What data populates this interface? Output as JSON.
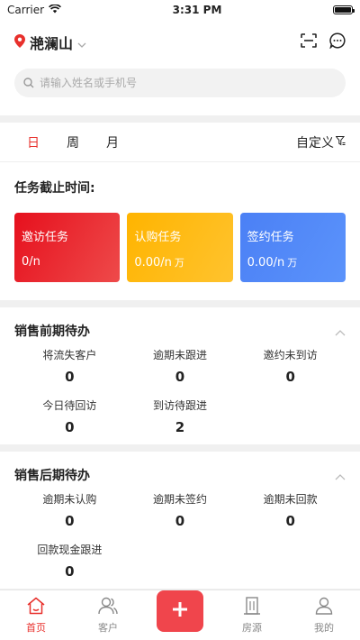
{
  "status_bar": {
    "carrier": "Carrier",
    "time": "3:31 PM",
    "battery_level": 1.0
  },
  "header": {
    "location": "滟澜山",
    "search_placeholder": "请输入姓名或手机号"
  },
  "period": {
    "tabs": [
      "日",
      "周",
      "月"
    ],
    "active_tab": "日",
    "custom_label": "自定义"
  },
  "tasks": {
    "label": "任务截止时间:",
    "cards": [
      {
        "title": "邀访任务",
        "value": "0/n",
        "unit": ""
      },
      {
        "title": "认购任务",
        "value": "0.00/n",
        "unit": "万"
      },
      {
        "title": "签约任务",
        "value": "0.00/n",
        "unit": "万"
      }
    ]
  },
  "pre_sales": {
    "title": "销售前期待办",
    "items": [
      {
        "label": "将流失客户",
        "value": "0"
      },
      {
        "label": "逾期未跟进",
        "value": "0"
      },
      {
        "label": "邀约未到访",
        "value": "0"
      },
      {
        "label": "今日待回访",
        "value": "0"
      },
      {
        "label": "到访待跟进",
        "value": "2"
      }
    ]
  },
  "post_sales": {
    "title": "销售后期待办",
    "items": [
      {
        "label": "逾期未认购",
        "value": "0"
      },
      {
        "label": "逾期未签约",
        "value": "0"
      },
      {
        "label": "逾期未回款",
        "value": "0"
      },
      {
        "label": "回款现金跟进",
        "value": "0"
      }
    ]
  },
  "bottom_nav": {
    "items": [
      {
        "label": "首页",
        "icon": "home-icon"
      },
      {
        "label": "客户",
        "icon": "customers-icon"
      },
      {
        "label": "",
        "icon": "plus-icon"
      },
      {
        "label": "房源",
        "icon": "building-icon"
      },
      {
        "label": "我的",
        "icon": "profile-icon"
      }
    ]
  },
  "colors": {
    "accent": "#e8302c",
    "card_red": "#e6101d",
    "card_yellow": "#ffb400",
    "card_blue": "#4b80f5"
  }
}
